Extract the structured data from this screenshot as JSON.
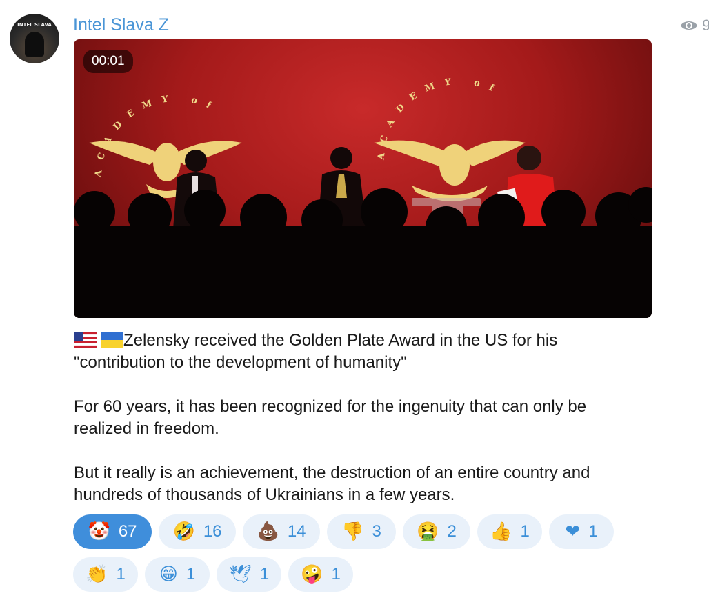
{
  "post": {
    "channel_name": "Intel Slava Z",
    "avatar_text": "INTEL SLAVA",
    "views": "9",
    "video": {
      "timestamp": "00:01",
      "academy_text": "ACADEMY of"
    },
    "caption": {
      "line1": "Zelensky received the Golden Plate Award in the US for his \"contribution to the development of humanity\"",
      "flags": [
        "us-flag",
        "ukraine-flag"
      ],
      "line2": "For 60 years, it has been recognized for the ingenuity that can only be realized in freedom.",
      "line3": "But it really is an achievement, the destruction of an entire country and hundreds of thousands of Ukrainians in a few years."
    },
    "reactions": [
      {
        "emoji": "🤡",
        "icon": "clown-icon",
        "count": "67",
        "active": true
      },
      {
        "emoji": "🤣",
        "icon": "rofl-icon",
        "count": "16",
        "active": false
      },
      {
        "emoji": "💩",
        "icon": "poop-icon",
        "count": "14",
        "active": false
      },
      {
        "emoji": "👎",
        "icon": "thumbs-down-icon",
        "count": "3",
        "active": false
      },
      {
        "emoji": "🤮",
        "icon": "vomit-icon",
        "count": "2",
        "active": false
      },
      {
        "emoji": "👍",
        "icon": "thumbs-up-icon",
        "count": "1",
        "active": false
      },
      {
        "emoji": "❤",
        "icon": "heart-icon",
        "count": "1",
        "active": false
      },
      {
        "emoji": "👏",
        "icon": "clap-icon",
        "count": "1",
        "active": false
      },
      {
        "emoji": "😁",
        "icon": "grin-icon",
        "count": "1",
        "active": false
      },
      {
        "emoji": "🕊",
        "icon": "dove-icon",
        "count": "1",
        "active": false
      },
      {
        "emoji": "🤪",
        "icon": "zany-icon",
        "count": "1",
        "active": false
      }
    ]
  }
}
